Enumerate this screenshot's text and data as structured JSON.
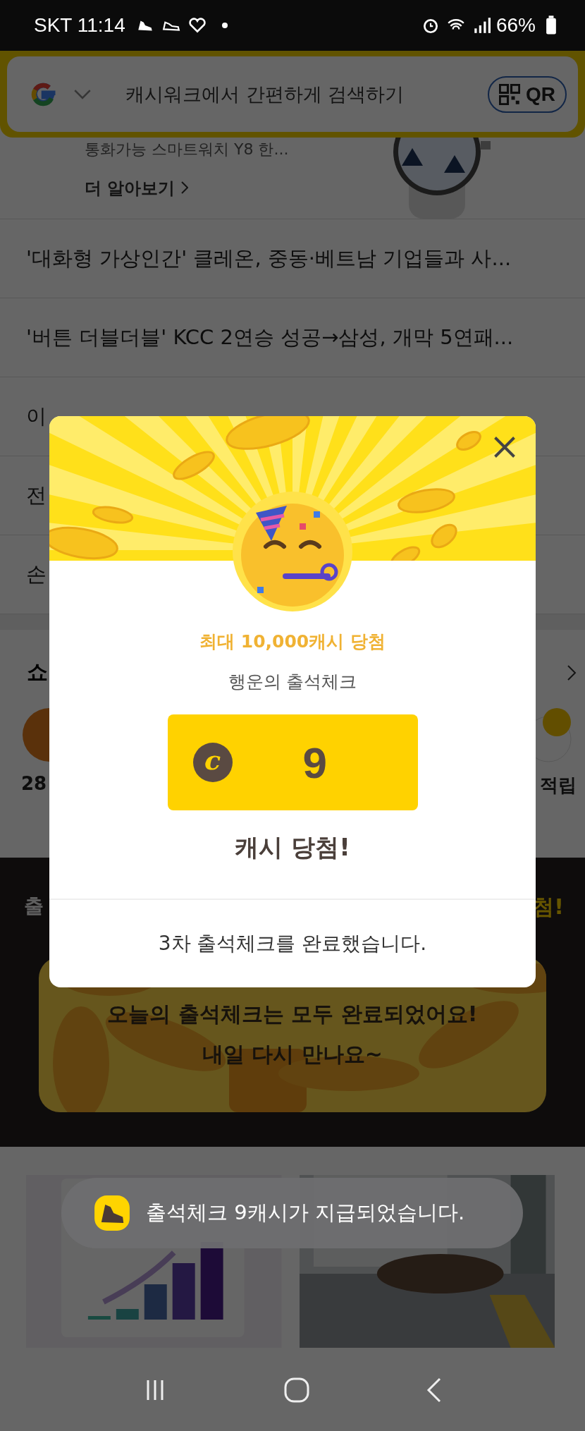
{
  "status_bar": {
    "carrier_time": "SKT 11:14",
    "battery": "66%"
  },
  "search": {
    "placeholder": "캐시워크에서 간편하게 검색하기",
    "qr_label": "QR"
  },
  "ad": {
    "subtitle": "통화가능 스마트워치 Y8 한...",
    "link": "더 알아보기"
  },
  "news": [
    {
      "title": "'대화형 가상인간' 클레온, 중동·베트남 기업들과 사..."
    },
    {
      "title": "'버튼 더블더블' KCC 2연승 성공→삼성, 개막 5연패..."
    },
    {
      "title": "이"
    },
    {
      "title": "전"
    },
    {
      "title": "손"
    }
  ],
  "shop": {
    "title": "쇼",
    "items": [
      {
        "label": "28"
      },
      {
        "label": "적립"
      }
    ]
  },
  "attendance": {
    "title_left": "출",
    "title_right": "첨!",
    "message": "오늘의 출석체크는 모두 완료되었어요!",
    "message_2": "내일 다시 만나요~"
  },
  "modal": {
    "headline": "최대 10,000캐시 당첨",
    "subtitle": "행운의 출석체크",
    "coin_symbol": "c",
    "amount": "9",
    "result": "캐시 당첨!",
    "footer": "3차 출석체크를 완료했습니다."
  },
  "toast": {
    "message": "출석체크 9캐시가 지급되었습니다."
  }
}
